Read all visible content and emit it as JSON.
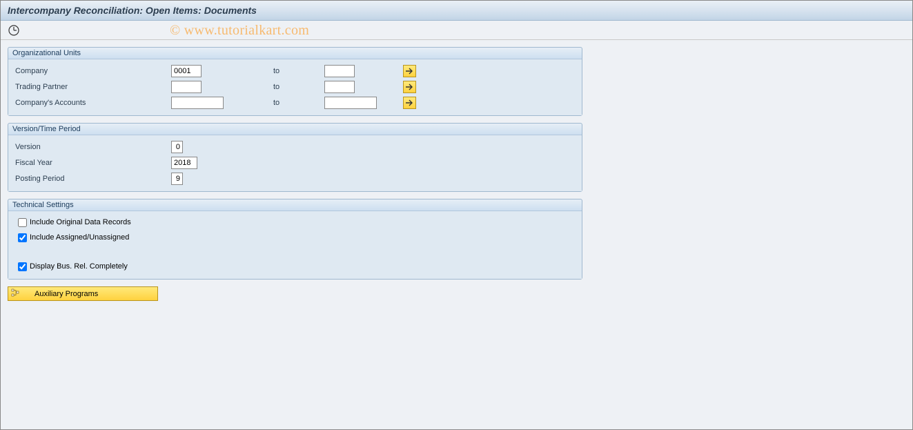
{
  "title": "Intercompany Reconciliation: Open Items: Documents",
  "watermark": "© www.tutorialkart.com",
  "groups": {
    "org": {
      "title": "Organizational Units",
      "rows": {
        "company": {
          "label": "Company",
          "from": "0001",
          "to_label": "to",
          "to": ""
        },
        "trading_partner": {
          "label": "Trading Partner",
          "from": "",
          "to_label": "to",
          "to": ""
        },
        "company_accounts": {
          "label": "Company's Accounts",
          "from": "",
          "to_label": "to",
          "to": ""
        }
      }
    },
    "version_time": {
      "title": "Version/Time Period",
      "rows": {
        "version": {
          "label": "Version",
          "value": "0"
        },
        "fiscal_year": {
          "label": "Fiscal Year",
          "value": "2018"
        },
        "posting_period": {
          "label": "Posting Period",
          "value": "9"
        }
      }
    },
    "technical": {
      "title": "Technical Settings",
      "checks": {
        "include_original": {
          "label": "Include Original Data Records",
          "checked": false
        },
        "include_assigned": {
          "label": "Include Assigned/Unassigned",
          "checked": true
        },
        "display_bus_rel": {
          "label": "Display Bus. Rel. Completely",
          "checked": true
        }
      }
    }
  },
  "aux_button": {
    "label": "Auxiliary Programs"
  }
}
